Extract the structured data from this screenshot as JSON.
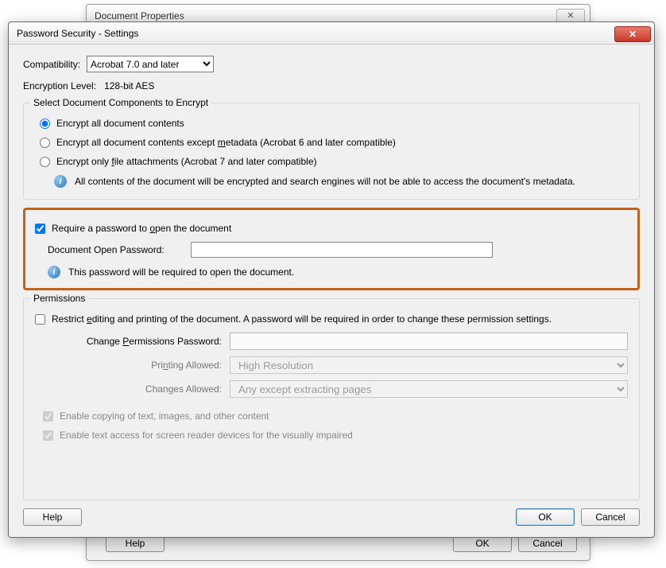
{
  "parent": {
    "title": "Document Properties",
    "help": "Help",
    "ok": "OK",
    "cancel": "Cancel"
  },
  "dialog": {
    "title": "Password Security - Settings",
    "close_glyph": "✕"
  },
  "compat": {
    "label": "Compatibility:",
    "value": "Acrobat 7.0 and later"
  },
  "encryption": {
    "label": "Encryption  Level:",
    "value": "128-bit AES"
  },
  "components": {
    "legend": "Select Document Components to Encrypt",
    "opt_all": "Encrypt all document contents",
    "opt_except_meta_pre": "Encrypt all document contents except ",
    "opt_except_meta_u": "m",
    "opt_except_meta_post": "etadata (Acrobat 6 and later compatible)",
    "opt_files_pre": "Encrypt only ",
    "opt_files_u": "f",
    "opt_files_post": "ile attachments (Acrobat 7 and later compatible)",
    "info": "All contents of the document will be encrypted and search engines will not be able to access the document's metadata."
  },
  "openpw": {
    "require_pre": "Require a password to ",
    "require_u": "o",
    "require_post": "pen the document",
    "label": "Document Open Password:",
    "info": "This password will be required to open the document."
  },
  "permissions": {
    "legend": "Permissions",
    "restrict_pre": "Restrict ",
    "restrict_u": "e",
    "restrict_post": "diting and printing of the document. A password will be required in order to change these permission settings.",
    "change_pw_pre": "Change ",
    "change_pw_u": "P",
    "change_pw_post": "ermissions Password:",
    "printing_pre": "Pri",
    "printing_u": "n",
    "printing_post": "ting Allowed:",
    "printing_value": "High Resolution",
    "changes_pre": "Chan",
    "changes_u": "g",
    "changes_post": "es Allowed:",
    "changes_value": "Any except extracting pages",
    "enable_copy": "Enable copying of text, images, and other content",
    "enable_access": "Enable text access for screen reader devices for the visually impaired"
  },
  "footer": {
    "help": "Help",
    "ok": "OK",
    "cancel": "Cancel"
  },
  "info_glyph": "i"
}
